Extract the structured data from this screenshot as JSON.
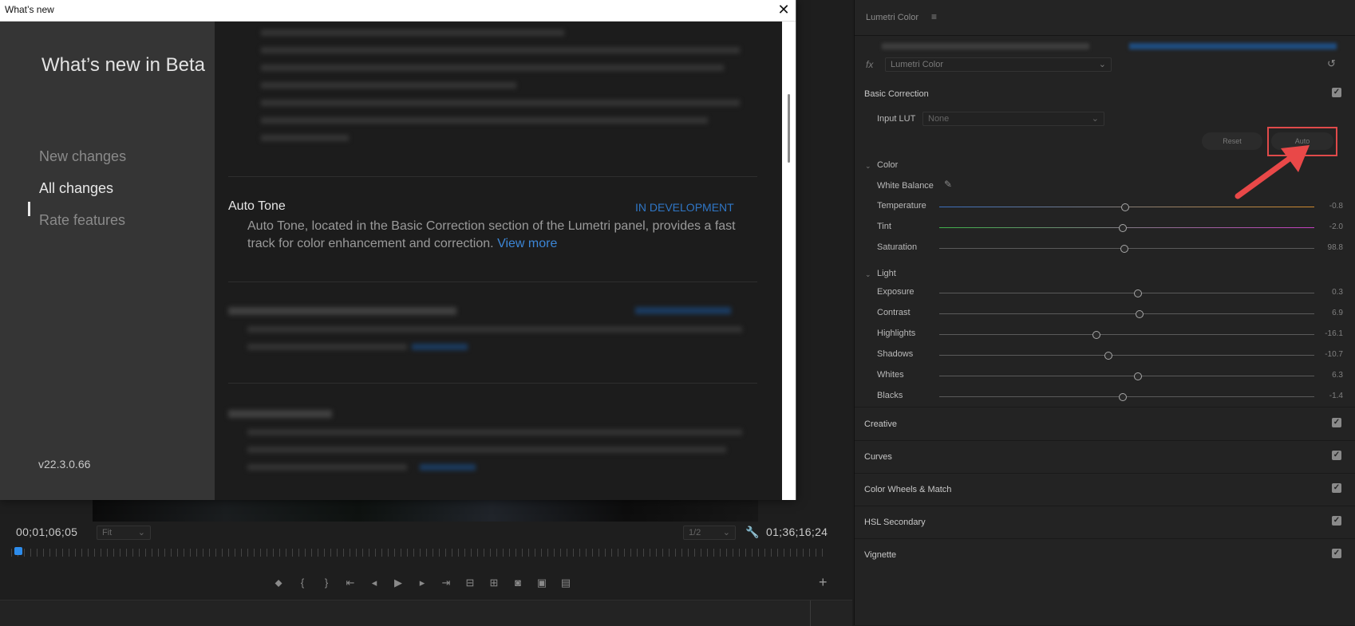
{
  "monitor": {
    "timecode_left": "00;01;06;05",
    "zoom_value": "Fit",
    "resolution_value": "1/2",
    "timecode_right": "01;36;16;24",
    "transport_icons": [
      "marker-icon",
      "mark-in-icon",
      "mark-out-icon",
      "go-to-in-icon",
      "step-back-icon",
      "play-icon",
      "step-forward-icon",
      "go-to-out-icon",
      "insert-icon",
      "overwrite-icon",
      "camera-icon",
      "compare-icon",
      "multi-cam-icon"
    ],
    "add_label": "+"
  },
  "dialog": {
    "window_title": "What’s new",
    "close_label": "✕",
    "sidebar": {
      "title": "What’s new in Beta",
      "nav": [
        {
          "label": "New changes"
        },
        {
          "label": "All changes"
        },
        {
          "label": "Rate features"
        }
      ],
      "version": "v22.3.0.66"
    },
    "features": [
      {
        "title": "Auto Tone",
        "status": "IN DEVELOPMENT",
        "desc": "Auto Tone, located in the Basic Correction section of the Lumetri panel, provides a fast track for color enhancement and correction.",
        "link": "View more"
      }
    ]
  },
  "lumetri": {
    "panel_title": "Lumetri Color",
    "menu_icon": "≡",
    "fx_label": "fx",
    "effect_value": "Lumetri Color",
    "basic_correction": {
      "label": "Basic Correction",
      "input_lut_label": "Input LUT",
      "input_lut_value": "None",
      "reset_label": "Reset",
      "auto_label": "Auto",
      "color_group": "Color",
      "white_balance_label": "White Balance",
      "sliders_color": [
        {
          "label": "Temperature",
          "value": "-0.8",
          "pos": 0.495
        },
        {
          "label": "Tint",
          "value": "-2.0",
          "pos": 0.49
        },
        {
          "label": "Saturation",
          "value": "98.8",
          "pos": 0.494
        }
      ],
      "light_group": "Light",
      "sliders_light": [
        {
          "label": "Exposure",
          "value": "0.3",
          "pos": 0.53
        },
        {
          "label": "Contrast",
          "value": "6.9",
          "pos": 0.535
        },
        {
          "label": "Highlights",
          "value": "-16.1",
          "pos": 0.42
        },
        {
          "label": "Shadows",
          "value": "-10.7",
          "pos": 0.45
        },
        {
          "label": "Whites",
          "value": "6.3",
          "pos": 0.53
        },
        {
          "label": "Blacks",
          "value": "-1.4",
          "pos": 0.49
        }
      ]
    },
    "sections": [
      {
        "label": "Creative"
      },
      {
        "label": "Curves"
      },
      {
        "label": "Color Wheels & Match"
      },
      {
        "label": "HSL Secondary"
      },
      {
        "label": "Vignette"
      }
    ],
    "colors": {
      "temperature_left": "#3a6fc0",
      "temperature_right": "#d08a2c",
      "tint_left": "#3fb24a",
      "tint_right": "#c53fc0",
      "highlight_box": "#e04a4a",
      "arrow": "#e94848"
    }
  }
}
